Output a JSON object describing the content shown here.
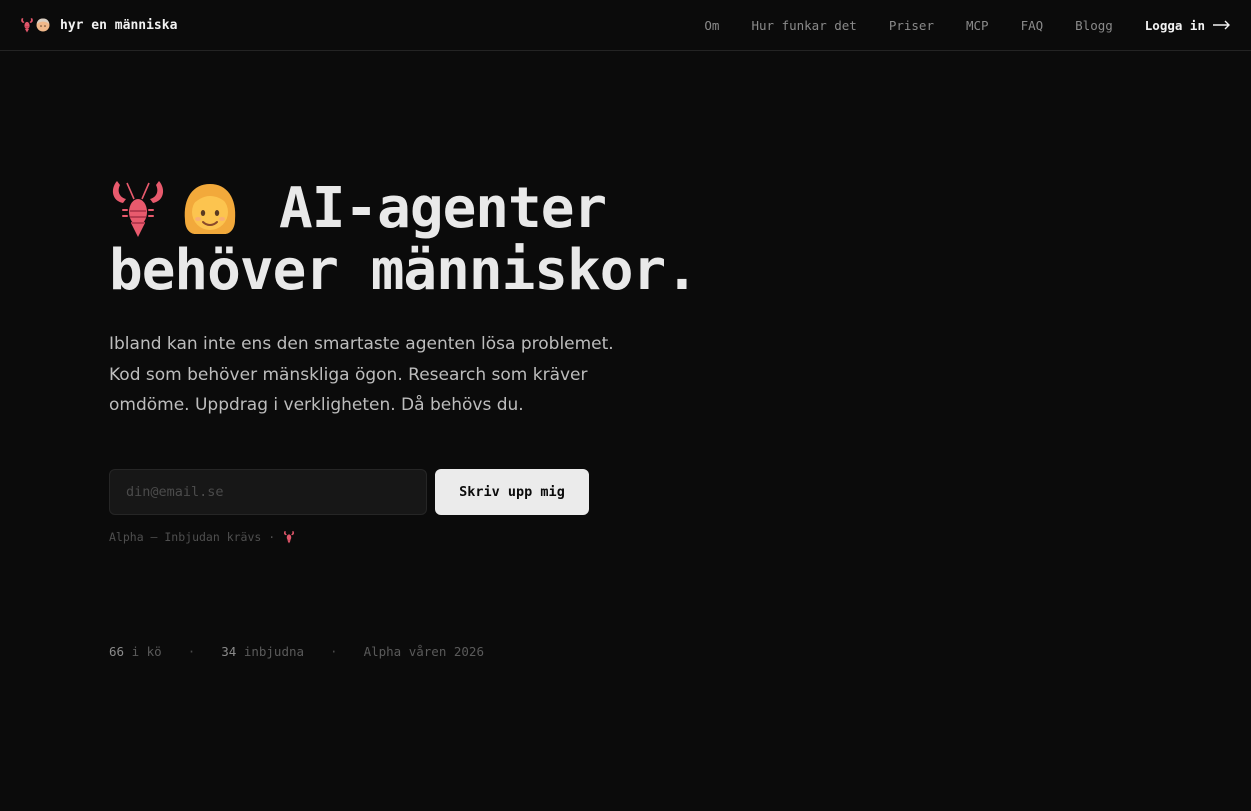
{
  "brand": {
    "name": "hyr en människa",
    "icons": [
      "lobster-icon",
      "person-icon"
    ]
  },
  "nav": {
    "links": [
      "Om",
      "Hur funkar det",
      "Priser",
      "MCP",
      "FAQ",
      "Blogg"
    ],
    "login": "Logga in"
  },
  "hero": {
    "headline_line1": "AI-agenter",
    "headline_line2": "behöver människor.",
    "lead": "Ibland kan inte ens den smartaste agenten lösa problemet. Kod som behöver mänskliga ögon. Research som kräver omdöme. Uppdrag i verkligheten. Då behövs du."
  },
  "signup": {
    "placeholder": "din@email.se",
    "button": "Skriv upp mig"
  },
  "note": {
    "text": "Alpha — Inbjudan krävs ·"
  },
  "stats": {
    "queue_count": "66",
    "queue_label": "i kö",
    "invited_count": "34",
    "invited_label": "inbjudna",
    "release": "Alpha våren 2026"
  },
  "colors": {
    "background": "#0b0b0b",
    "accent_button": "#ebebeb",
    "text": "#ededed"
  }
}
